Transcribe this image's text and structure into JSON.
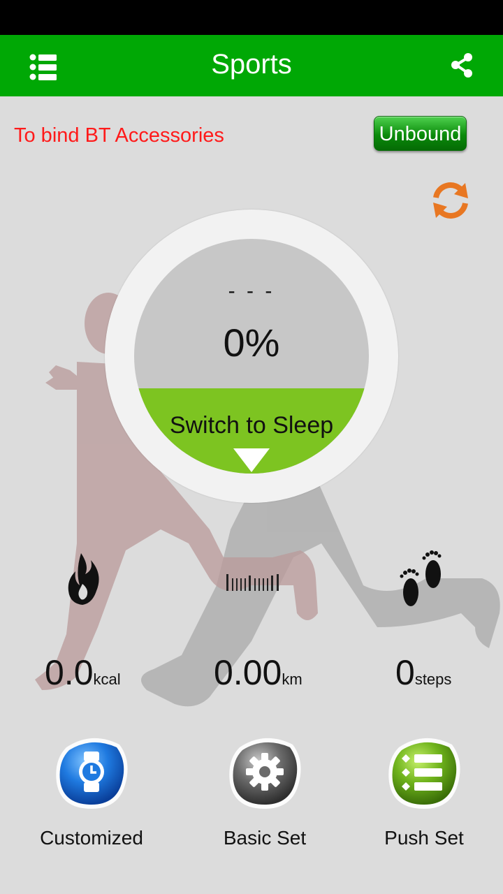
{
  "app": {
    "title": "Sports"
  },
  "bind": {
    "message": "To bind BT Accessories",
    "button_label": "Unbound"
  },
  "gauge": {
    "status": "- - -",
    "percent": "0%",
    "switch_label": "Switch to Sleep"
  },
  "stats": {
    "calories": {
      "value": "0.0",
      "unit": "kcal"
    },
    "distance": {
      "value": "0.00",
      "unit": "km"
    },
    "steps": {
      "value": "0",
      "unit": "steps"
    }
  },
  "actions": [
    {
      "label": "Customized",
      "icon": "watch-icon"
    },
    {
      "label": "Basic Set",
      "icon": "gear-icon"
    },
    {
      "label": "Push Set",
      "icon": "list-icon"
    }
  ],
  "colors": {
    "appbar": "#00a805",
    "bind_text": "#ff1a1a",
    "refresh": "#e87722",
    "gauge_green": "#7dc421"
  }
}
